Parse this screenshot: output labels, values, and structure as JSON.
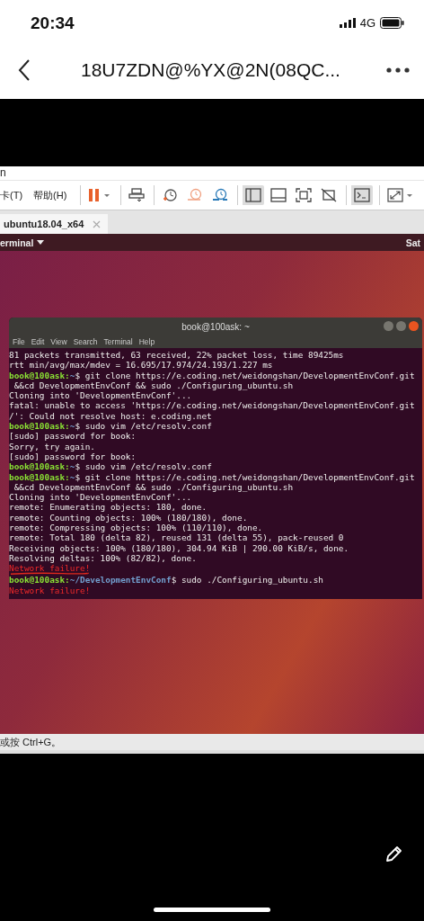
{
  "status_bar": {
    "time": "20:34",
    "network": "4G"
  },
  "nav": {
    "title": "18U7ZDN@%YX@2N(08QC..."
  },
  "vm_screenshot": {
    "title_fragment": "n",
    "menu": [
      "卡(T)",
      "帮助(H)"
    ],
    "toolbar": [
      {
        "kind": "pause",
        "selected": false,
        "separator_before": true
      },
      {
        "kind": "send",
        "selected": false,
        "separator_before": true
      },
      {
        "kind": "snapshot",
        "selected": false,
        "separator_before": true
      },
      {
        "kind": "revert",
        "selected": false,
        "separator_before": false
      },
      {
        "kind": "manager",
        "selected": false,
        "separator_before": false
      },
      {
        "kind": "library",
        "selected": true,
        "separator_before": true
      },
      {
        "kind": "thumbs",
        "selected": false,
        "separator_before": false
      },
      {
        "kind": "full",
        "selected": false,
        "separator_before": false
      },
      {
        "kind": "unity",
        "selected": false,
        "separator_before": false
      },
      {
        "kind": "console",
        "selected": true,
        "separator_before": true
      },
      {
        "kind": "stretch",
        "selected": false,
        "separator_before": true
      }
    ],
    "tab": {
      "label": "ubuntu18.04_x64"
    },
    "top_bar": {
      "app_menu": "erminal",
      "clock": "Sat"
    },
    "terminal": {
      "title": "book@100ask: ~",
      "menu": [
        "File",
        "Edit",
        "View",
        "Search",
        "Terminal",
        "Help"
      ],
      "lines": [
        {
          "kind": "output",
          "text": "81 packets transmitted, 63 received, 22% packet loss, time 89425ms"
        },
        {
          "kind": "output",
          "text": "rtt min/avg/max/mdev = 16.695/17.974/24.193/1.227 ms"
        },
        {
          "kind": "prompt",
          "user": "book@100ask:",
          "path": "~",
          "command": "$ git clone https://e.coding.net/weidongshan/DevelopmentEnvConf.git"
        },
        {
          "kind": "output",
          "text": " &&cd DevelopmentEnvConf && sudo ./Configuring_ubuntu.sh"
        },
        {
          "kind": "output",
          "text": "Cloning into 'DevelopmentEnvConf'..."
        },
        {
          "kind": "output",
          "text": "fatal: unable to access 'https://e.coding.net/weidongshan/DevelopmentEnvConf.git"
        },
        {
          "kind": "output",
          "text": "/': Could not resolve host: e.coding.net"
        },
        {
          "kind": "prompt",
          "user": "book@100ask:",
          "path": "~",
          "command": "$ sudo vim /etc/resolv.conf"
        },
        {
          "kind": "output",
          "text": "[sudo] password for book:"
        },
        {
          "kind": "output",
          "text": "Sorry, try again."
        },
        {
          "kind": "output",
          "text": "[sudo] password for book:"
        },
        {
          "kind": "prompt",
          "user": "book@100ask:",
          "path": "~",
          "command": "$ sudo vim /etc/resolv.conf"
        },
        {
          "kind": "prompt",
          "user": "book@100ask:",
          "path": "~",
          "command": "$ git clone https://e.coding.net/weidongshan/DevelopmentEnvConf.git"
        },
        {
          "kind": "output",
          "text": " &&cd DevelopmentEnvConf && sudo ./Configuring_ubuntu.sh"
        },
        {
          "kind": "output",
          "text": "Cloning into 'DevelopmentEnvConf'..."
        },
        {
          "kind": "output",
          "text": "remote: Enumerating objects: 180, done."
        },
        {
          "kind": "output",
          "text": "remote: Counting objects: 100% (180/180), done."
        },
        {
          "kind": "output",
          "text": "remote: Compressing objects: 100% (110/110), done."
        },
        {
          "kind": "output",
          "text": "remote: Total 180 (delta 82), reused 131 (delta 55), pack-reused 0"
        },
        {
          "kind": "output",
          "text": "Receiving objects: 100% (180/180), 304.94 KiB | 290.00 KiB/s, done."
        },
        {
          "kind": "output",
          "text": "Resolving deltas: 100% (82/82), done."
        },
        {
          "kind": "error",
          "text": "Network failure!",
          "underlined": true
        },
        {
          "kind": "prompt",
          "user": "book@100ask:",
          "path": "~/DevelopmentEnvConf",
          "command": "$ sudo ./Configuring_ubuntu.sh"
        },
        {
          "kind": "error",
          "text": "Network failure!",
          "underlined": false
        }
      ]
    },
    "status_text": "或按 Ctrl+G。"
  }
}
